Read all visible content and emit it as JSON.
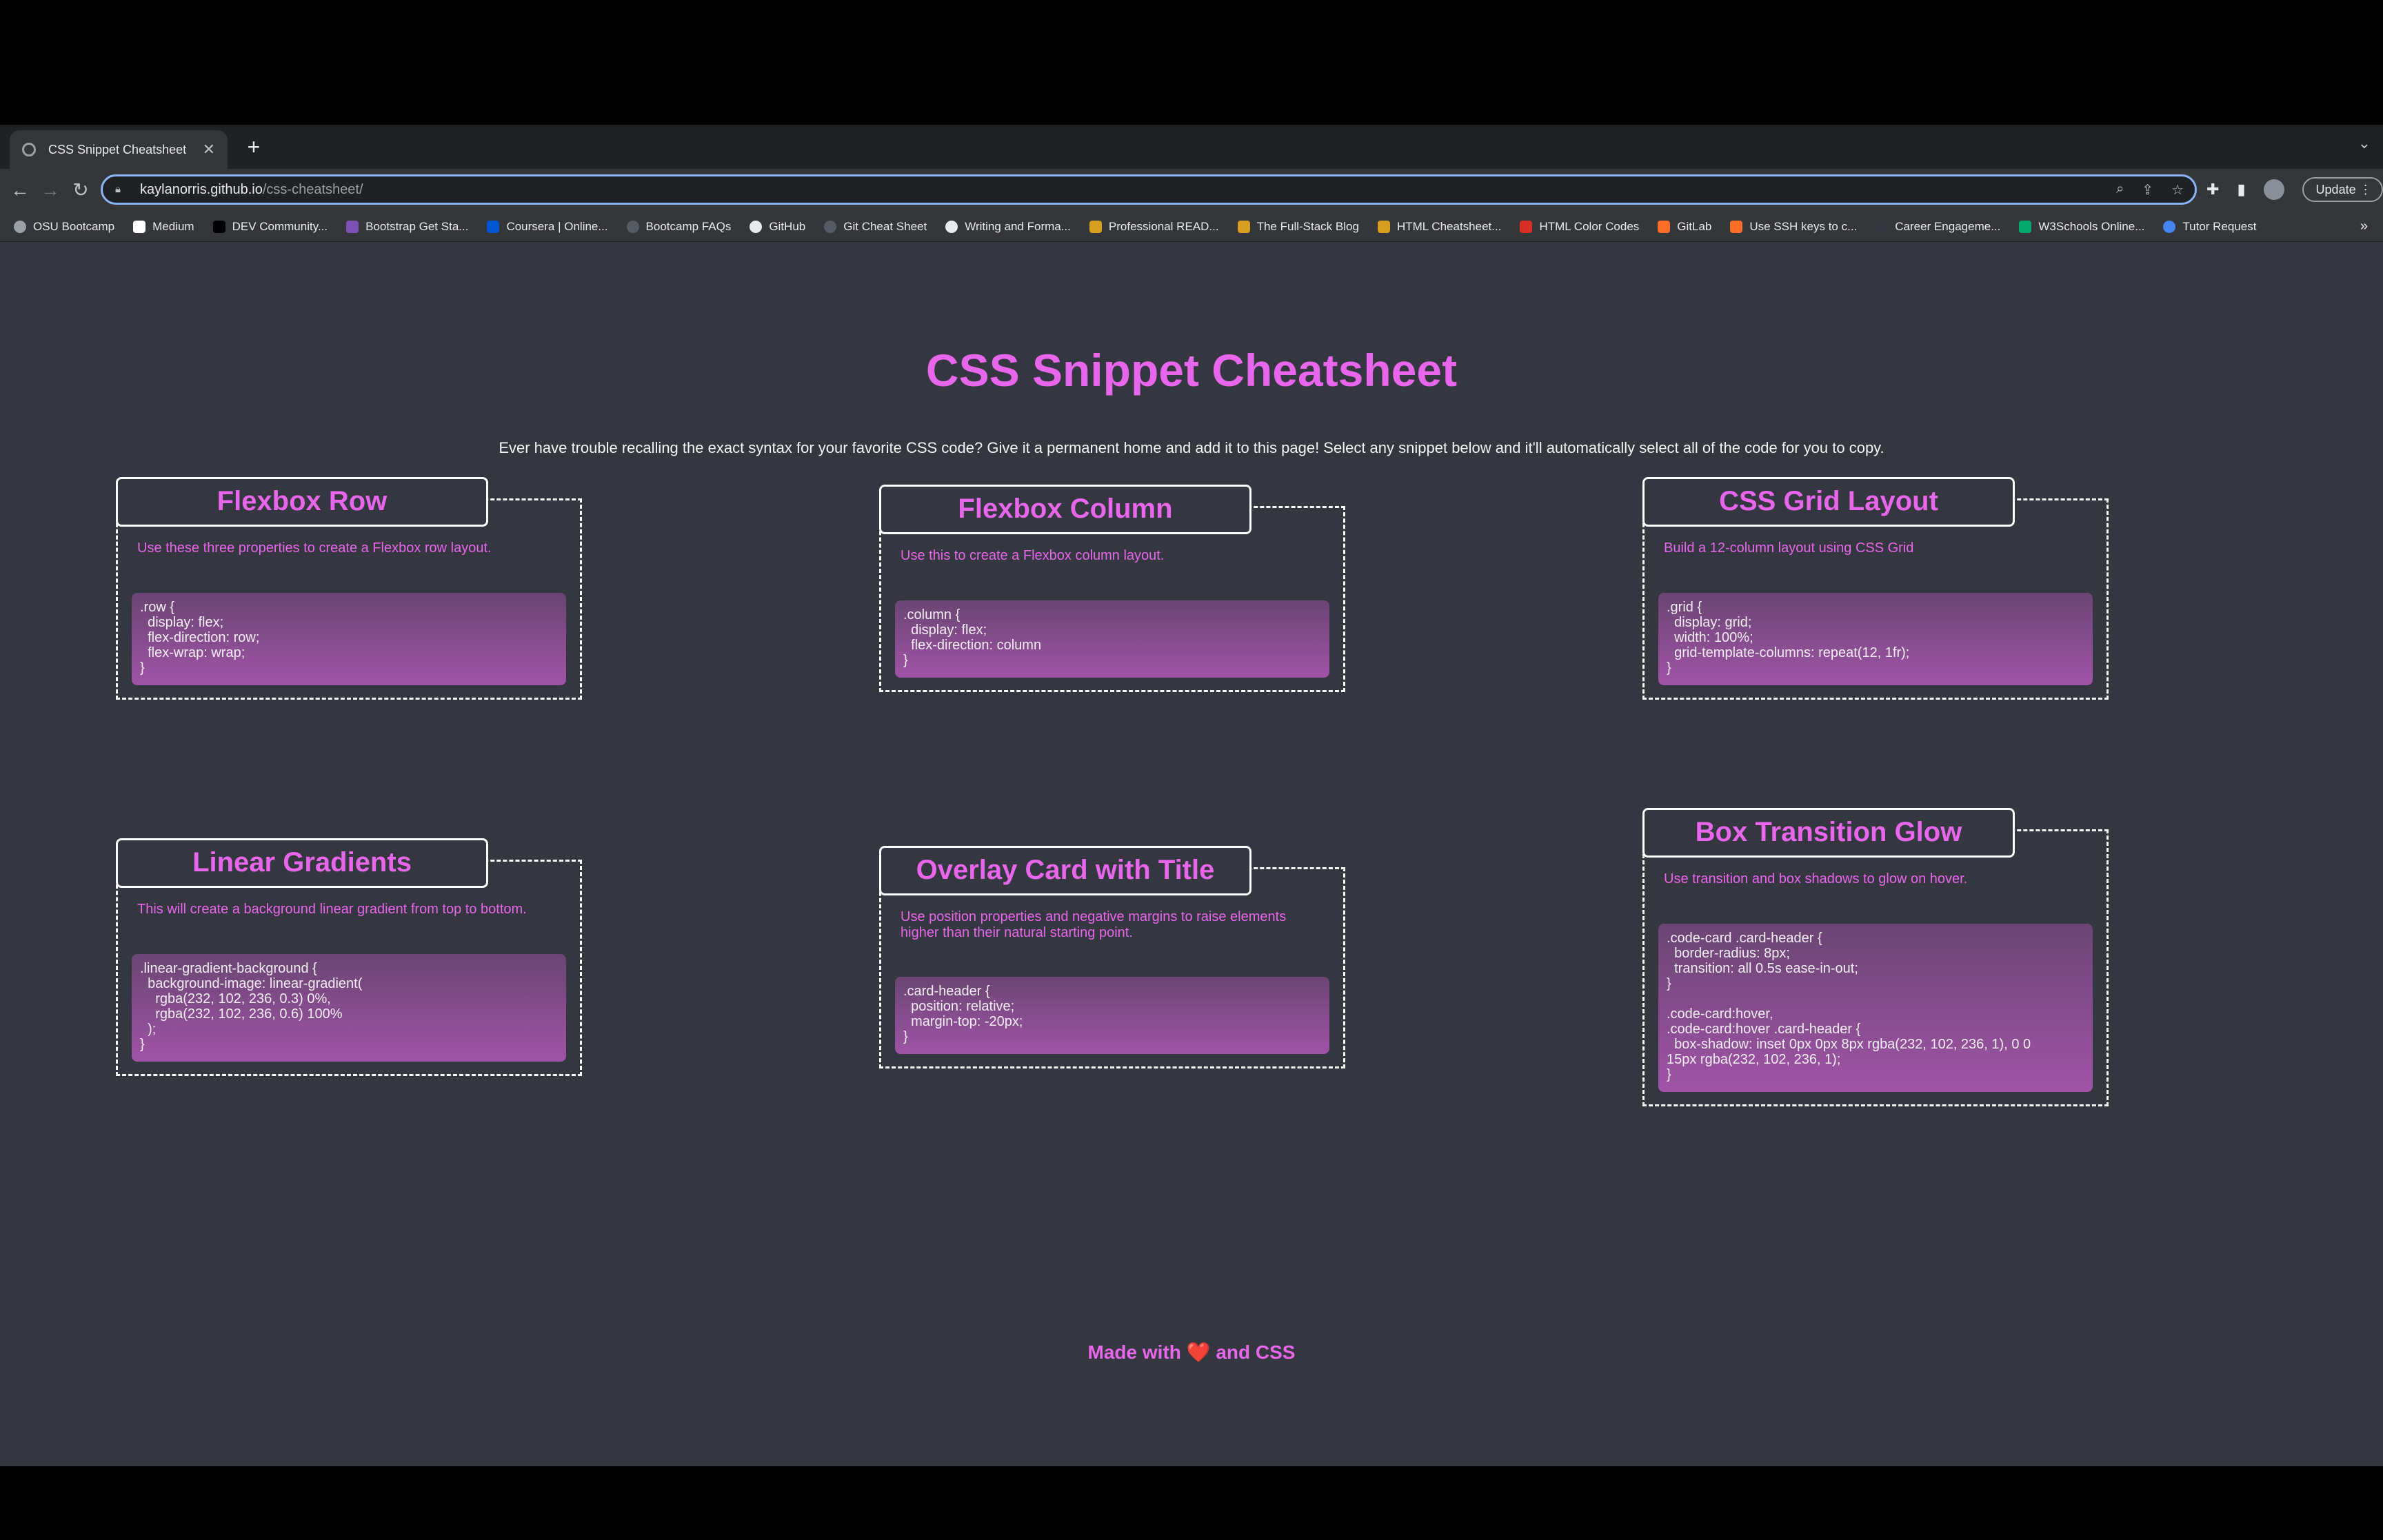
{
  "browser": {
    "tab_title": "CSS Snippet Cheatsheet",
    "url_host": "kaylanorris.github.io",
    "url_path": "/css-cheatsheet/",
    "update_label": "Update",
    "bookmarks": [
      {
        "label": "OSU Bootcamp",
        "icon": "globe-icon",
        "color": "#9aa0a6"
      },
      {
        "label": "Medium",
        "icon": "medium-icon",
        "color": "#ffffff"
      },
      {
        "label": "DEV Community...",
        "icon": "dev-icon",
        "color": "#000000"
      },
      {
        "label": "Bootstrap Get Sta...",
        "icon": "bootstrap-icon",
        "color": "#7952b3"
      },
      {
        "label": "Coursera | Online...",
        "icon": "coursera-icon",
        "color": "#0056d2"
      },
      {
        "label": "Bootcamp FAQs",
        "icon": "globe-icon",
        "color": "#555a63"
      },
      {
        "label": "GitHub",
        "icon": "github-icon",
        "color": "#e8eaed"
      },
      {
        "label": "Git Cheat Sheet",
        "icon": "github-icon",
        "color": "#555a63"
      },
      {
        "label": "Writing and Forma...",
        "icon": "github-icon",
        "color": "#e8eaed"
      },
      {
        "label": "Professional READ...",
        "icon": "bookmark-icon",
        "color": "#d79f20"
      },
      {
        "label": "The Full-Stack Blog",
        "icon": "bookmark-icon",
        "color": "#d79f20"
      },
      {
        "label": "HTML Cheatsheet...",
        "icon": "bookmark-icon",
        "color": "#d79f20"
      },
      {
        "label": "HTML Color Codes",
        "icon": "colorcodes-icon",
        "color": "#d93025"
      },
      {
        "label": "GitLab",
        "icon": "gitlab-icon",
        "color": "#fc6d26"
      },
      {
        "label": "Use SSH keys to c...",
        "icon": "gitlab-icon",
        "color": "#fc6d26"
      },
      {
        "label": "Career Engageme...",
        "icon": "arrow-icon",
        "color": "#34373f"
      },
      {
        "label": "W3Schools Online...",
        "icon": "w3schools-icon",
        "color": "#04aa6d"
      },
      {
        "label": "Tutor Request",
        "icon": "globe-icon",
        "color": "#4285f4"
      }
    ]
  },
  "page": {
    "title": "CSS Snippet Cheatsheet",
    "intro": "Ever have trouble recalling the exact syntax for your favorite CSS code? Give it a permanent home and add it to this page! Select any snippet below and it'll automatically select all of the code for you to copy.",
    "cards": [
      {
        "title": "Flexbox Row",
        "description": "Use these three properties to create a Flexbox row layout.",
        "code": ".row {\n  display: flex;\n  flex-direction: row;\n  flex-wrap: wrap;\n}"
      },
      {
        "title": "Flexbox Column",
        "description": "Use this to create a Flexbox column layout.",
        "code": ".column {\n  display: flex;\n  flex-direction: column\n}"
      },
      {
        "title": "CSS Grid Layout",
        "description": "Build a 12-column layout using CSS Grid",
        "code": ".grid {\n  display: grid;\n  width: 100%;\n  grid-template-columns: repeat(12, 1fr);\n}"
      },
      {
        "title": "Linear Gradients",
        "description": "This will create a background linear gradient from top to bottom.",
        "code": ".linear-gradient-background {\n  background-image: linear-gradient(\n    rgba(232, 102, 236, 0.3) 0%,\n    rgba(232, 102, 236, 0.6) 100%\n  );\n}"
      },
      {
        "title": "Overlay Card with Title",
        "description": "Use position properties and negative margins to raise elements higher than their natural starting point.",
        "code": ".card-header {\n  position: relative;\n  margin-top: -20px;\n}"
      },
      {
        "title": "Box Transition Glow",
        "description": "Use transition and box shadows to glow on hover.",
        "code": ".code-card .card-header {\n  border-radius: 8px;\n  transition: all 0.5s ease-in-out;\n}\n\n.code-card:hover,\n.code-card:hover .card-header {\n  box-shadow: inset 0px 0px 8px rgba(232, 102, 236, 1), 0 0\n15px rgba(232, 102, 236, 1);\n}"
      }
    ],
    "footer": {
      "before": "Made with",
      "heart": "❤️",
      "after": "and CSS"
    }
  }
}
